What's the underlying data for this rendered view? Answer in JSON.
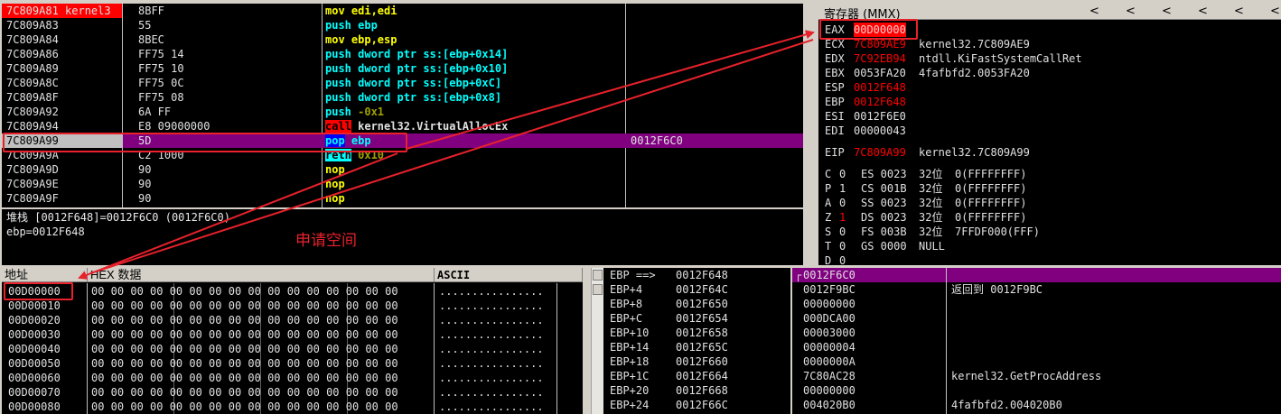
{
  "disasm": {
    "rows": [
      {
        "addr": "7C809A81 kernel3",
        "hex": "8BFF",
        "asm": [
          {
            "t": "mov edi,edi",
            "c": "#ffff00"
          }
        ],
        "cmt": "",
        "style": "addr-red"
      },
      {
        "addr": "7C809A83",
        "hex": "55",
        "asm": [
          {
            "t": "push ebp",
            "c": "#00ffff"
          }
        ],
        "cmt": ""
      },
      {
        "addr": "7C809A84",
        "hex": "8BEC",
        "asm": [
          {
            "t": "mov ebp,esp",
            "c": "#ffff00"
          }
        ],
        "cmt": ""
      },
      {
        "addr": "7C809A86",
        "hex": "FF75 14",
        "asm": [
          {
            "t": "push ",
            "c": "#00ffff"
          },
          {
            "t": "dword ptr ss:[ebp+0x14]",
            "c": "#00ffff"
          }
        ],
        "cmt": ""
      },
      {
        "addr": "7C809A89",
        "hex": "FF75 10",
        "asm": [
          {
            "t": "push ",
            "c": "#00ffff"
          },
          {
            "t": "dword ptr ss:[ebp+0x10]",
            "c": "#00ffff"
          }
        ],
        "cmt": ""
      },
      {
        "addr": "7C809A8C",
        "hex": "FF75 0C",
        "asm": [
          {
            "t": "push ",
            "c": "#00ffff"
          },
          {
            "t": "dword ptr ss:[ebp+0xC]",
            "c": "#00ffff"
          }
        ],
        "cmt": ""
      },
      {
        "addr": "7C809A8F",
        "hex": "FF75 08",
        "asm": [
          {
            "t": "push ",
            "c": "#00ffff"
          },
          {
            "t": "dword ptr ss:[ebp+0x8]",
            "c": "#00ffff"
          }
        ],
        "cmt": ""
      },
      {
        "addr": "7C809A92",
        "hex": "6A FF",
        "asm": [
          {
            "t": "push ",
            "c": "#00ffff"
          },
          {
            "t": "-0x1",
            "c": "#a0a000"
          }
        ],
        "cmt": ""
      },
      {
        "addr": "7C809A94",
        "hex": "E8 09000000",
        "asm": [
          {
            "t": "call",
            "c": "#000000",
            "bg": "#ff0000"
          },
          {
            "t": " kernel32.VirtualAllocEx",
            "c": "#e0e0e0"
          }
        ],
        "cmt": ""
      },
      {
        "addr": "7C809A99",
        "hex": "5D",
        "asm": [
          {
            "t": "pop",
            "c": "#00ffff",
            "bg": "#0000ff"
          },
          {
            "t": " ebp",
            "c": "#00ffff"
          }
        ],
        "cmt": "0012F6C0",
        "style": "current"
      },
      {
        "addr": "7C809A9A",
        "hex": "C2 1000",
        "asm": [
          {
            "t": "retn",
            "c": "#000000",
            "bg": "#00ffff"
          },
          {
            "t": " 0x10",
            "c": "#a0a000"
          }
        ],
        "cmt": ""
      },
      {
        "addr": "7C809A9D",
        "hex": "90",
        "asm": [
          {
            "t": "nop",
            "c": "#ffff00"
          }
        ],
        "cmt": ""
      },
      {
        "addr": "7C809A9E",
        "hex": "90",
        "asm": [
          {
            "t": "nop",
            "c": "#ffff00"
          }
        ],
        "cmt": ""
      },
      {
        "addr": "7C809A9F",
        "hex": "90",
        "asm": [
          {
            "t": "nop",
            "c": "#ffff00"
          }
        ],
        "cmt": ""
      }
    ]
  },
  "info": {
    "line1": "堆栈 [0012F648]=0012F6C0 (0012F6C0)",
    "line2": "ebp=0012F648"
  },
  "registers": {
    "title": "寄存器 (MMX)",
    "nav_arrows": [
      "<",
      "<",
      "<",
      "<",
      "<",
      "<",
      "<"
    ],
    "regs": [
      {
        "name": "EAX",
        "value": "00D00000",
        "desc": "",
        "color": "#ff0000",
        "highlight": true
      },
      {
        "name": "ECX",
        "value": "7C809AE9",
        "desc": "kernel32.7C809AE9",
        "color": "#ff0000"
      },
      {
        "name": "EDX",
        "value": "7C92EB94",
        "desc": "ntdll.KiFastSystemCallRet",
        "color": "#ff0000"
      },
      {
        "name": "EBX",
        "value": "0053FA20",
        "desc": "4fafbfd2.0053FA20",
        "color": "#e0e0e0"
      },
      {
        "name": "ESP",
        "value": "0012F648",
        "desc": "",
        "color": "#ff0000"
      },
      {
        "name": "EBP",
        "value": "0012F648",
        "desc": "",
        "color": "#ff0000"
      },
      {
        "name": "ESI",
        "value": "0012F6E0",
        "desc": "",
        "color": "#e0e0e0"
      },
      {
        "name": "EDI",
        "value": "00000043",
        "desc": "",
        "color": "#e0e0e0"
      }
    ],
    "eip": {
      "name": "EIP",
      "value": "7C809A99",
      "desc": "kernel32.7C809A99"
    },
    "flags": [
      {
        "f": "C",
        "v": "0",
        "seg": "ES",
        "sel": "0023",
        "bits": "32位",
        "base": "0(FFFFFFFF)"
      },
      {
        "f": "P",
        "v": "1",
        "seg": "CS",
        "sel": "001B",
        "bits": "32位",
        "base": "0(FFFFFFFF)"
      },
      {
        "f": "A",
        "v": "0",
        "seg": "SS",
        "sel": "0023",
        "bits": "32位",
        "base": "0(FFFFFFFF)"
      },
      {
        "f": "Z",
        "v": "1",
        "seg": "DS",
        "sel": "0023",
        "bits": "32位",
        "base": "0(FFFFFFFF)",
        "vred": true
      },
      {
        "f": "S",
        "v": "0",
        "seg": "FS",
        "sel": "003B",
        "bits": "32位",
        "base": "7FFDF000(FFF)"
      },
      {
        "f": "T",
        "v": "0",
        "seg": "GS",
        "sel": "0000",
        "bits": "NULL",
        "base": ""
      },
      {
        "f": "D",
        "v": "0",
        "seg": "",
        "sel": "",
        "bits": "",
        "base": ""
      }
    ]
  },
  "dump": {
    "headers": {
      "addr": "地址",
      "hex": "HEX 数据",
      "ascii": "ASCII"
    },
    "rows": [
      {
        "addr": "00D00000",
        "hex": "00 00 00 00 00 00 00 00 00 00 00 00 00 00 00 00",
        "ascii": "................"
      },
      {
        "addr": "00D00010",
        "hex": "00 00 00 00 00 00 00 00 00 00 00 00 00 00 00 00",
        "ascii": "................"
      },
      {
        "addr": "00D00020",
        "hex": "00 00 00 00 00 00 00 00 00 00 00 00 00 00 00 00",
        "ascii": "................"
      },
      {
        "addr": "00D00030",
        "hex": "00 00 00 00 00 00 00 00 00 00 00 00 00 00 00 00",
        "ascii": "................"
      },
      {
        "addr": "00D00040",
        "hex": "00 00 00 00 00 00 00 00 00 00 00 00 00 00 00 00",
        "ascii": "................"
      },
      {
        "addr": "00D00050",
        "hex": "00 00 00 00 00 00 00 00 00 00 00 00 00 00 00 00",
        "ascii": "................"
      },
      {
        "addr": "00D00060",
        "hex": "00 00 00 00 00 00 00 00 00 00 00 00 00 00 00 00",
        "ascii": "................"
      },
      {
        "addr": "00D00070",
        "hex": "00 00 00 00 00 00 00 00 00 00 00 00 00 00 00 00",
        "ascii": "................"
      },
      {
        "addr": "00D00080",
        "hex": "00 00 00 00 00 00 00 00 00 00 00 00 00 00 00 00",
        "ascii": "................"
      }
    ]
  },
  "stack_ebp": {
    "rows": [
      {
        "label": "EBP ==>",
        "value": "0012F648"
      },
      {
        "label": "EBP+4",
        "value": "0012F64C"
      },
      {
        "label": "EBP+8",
        "value": "0012F650"
      },
      {
        "label": "EBP+C",
        "value": "0012F654"
      },
      {
        "label": "EBP+10",
        "value": "0012F658"
      },
      {
        "label": "EBP+14",
        "value": "0012F65C"
      },
      {
        "label": "EBP+18",
        "value": "0012F660"
      },
      {
        "label": "EBP+1C",
        "value": "0012F664"
      },
      {
        "label": "EBP+20",
        "value": "0012F668"
      },
      {
        "label": "EBP+24",
        "value": "0012F66C"
      }
    ]
  },
  "stack_values": {
    "rows": [
      {
        "value": "0012F6C0",
        "comment": ""
      },
      {
        "value": "0012F9BC",
        "comment": "返回到 0012F9BC"
      },
      {
        "value": "00000000",
        "comment": ""
      },
      {
        "value": "000DCA00",
        "comment": ""
      },
      {
        "value": "00003000",
        "comment": ""
      },
      {
        "value": "00000004",
        "comment": ""
      },
      {
        "value": "0000000A",
        "comment": ""
      },
      {
        "value": "7C80AC28",
        "comment": "kernel32.GetProcAddress"
      },
      {
        "value": "00000000",
        "comment": ""
      },
      {
        "value": "004020B0",
        "comment": "4fafbfd2.004020B0"
      }
    ]
  },
  "annotation": {
    "label": "申请空间"
  }
}
